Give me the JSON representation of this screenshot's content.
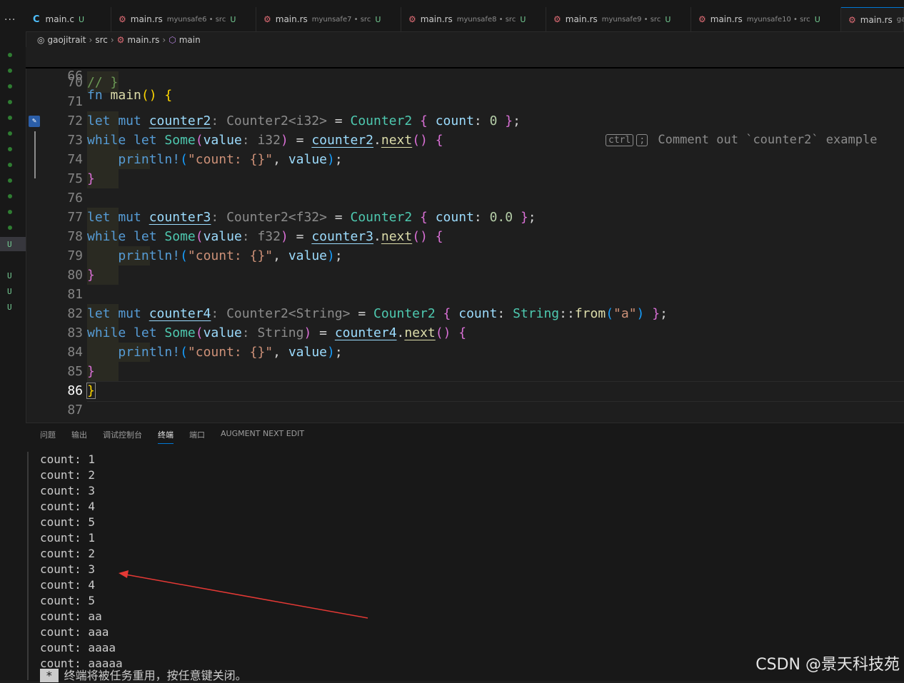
{
  "left_strip": {
    "more_label": "...",
    "u_markers": [
      "U",
      "U",
      "U",
      "U"
    ]
  },
  "tabs": [
    {
      "name": "main.c",
      "desc": "",
      "status": "U"
    },
    {
      "name": "main.rs",
      "desc": "myunsafe6 • src",
      "status": "U"
    },
    {
      "name": "main.rs",
      "desc": "myunsafe7 • src",
      "status": "U"
    },
    {
      "name": "main.rs",
      "desc": "myunsafe8 • src",
      "status": "U"
    },
    {
      "name": "main.rs",
      "desc": "myunsafe9 • src",
      "status": "U"
    },
    {
      "name": "main.rs",
      "desc": "myunsafe10 • src",
      "status": "U"
    },
    {
      "name": "main.rs",
      "desc": "ga",
      "status": ""
    }
  ],
  "breadcrumb": {
    "project": "gaojitrait",
    "folder": "src",
    "file": "main.rs",
    "symbol": "main"
  },
  "editor": {
    "sticky": {
      "line_no": "66",
      "text_kw": "fn",
      "text_fn": "main",
      "text_rest": "() {"
    },
    "codelens": {
      "key1": "ctrl",
      "key2": ";",
      "text": "Comment out `counter2` example"
    },
    "lines": [
      {
        "n": "70",
        "id": "l70"
      },
      {
        "n": "71",
        "id": "l71"
      },
      {
        "n": "72",
        "id": "l72"
      },
      {
        "n": "73",
        "id": "l73"
      },
      {
        "n": "74",
        "id": "l74"
      },
      {
        "n": "75",
        "id": "l75"
      },
      {
        "n": "76",
        "id": "l76"
      },
      {
        "n": "77",
        "id": "l77"
      },
      {
        "n": "78",
        "id": "l78"
      },
      {
        "n": "79",
        "id": "l79"
      },
      {
        "n": "80",
        "id": "l80"
      },
      {
        "n": "81",
        "id": "l81"
      },
      {
        "n": "82",
        "id": "l82"
      },
      {
        "n": "83",
        "id": "l83"
      },
      {
        "n": "84",
        "id": "l84"
      },
      {
        "n": "85",
        "id": "l85"
      },
      {
        "n": "86",
        "id": "l86"
      },
      {
        "n": "87",
        "id": "l87"
      }
    ]
  },
  "panel": {
    "tabs": [
      "问题",
      "输出",
      "调试控制台",
      "终端",
      "端口",
      "AUGMENT NEXT EDIT"
    ],
    "active_tab": "终端",
    "terminal_lines": [
      "count: 1",
      "count: 2",
      "count: 3",
      "count: 4",
      "count: 5",
      "count: 1",
      "count: 2",
      "count: 3",
      "count: 4",
      "count: 5",
      "count: aa",
      "count: aaa",
      "count: aaaa",
      "count: aaaaa"
    ],
    "footer_star": "*",
    "footer_text": "终端将被任务重用，按任意键关闭。"
  },
  "watermark": "CSDN @景天科技苑",
  "colors": {
    "accent": "#0078d4",
    "arrow": "#e53935",
    "untracked": "#73c991"
  }
}
